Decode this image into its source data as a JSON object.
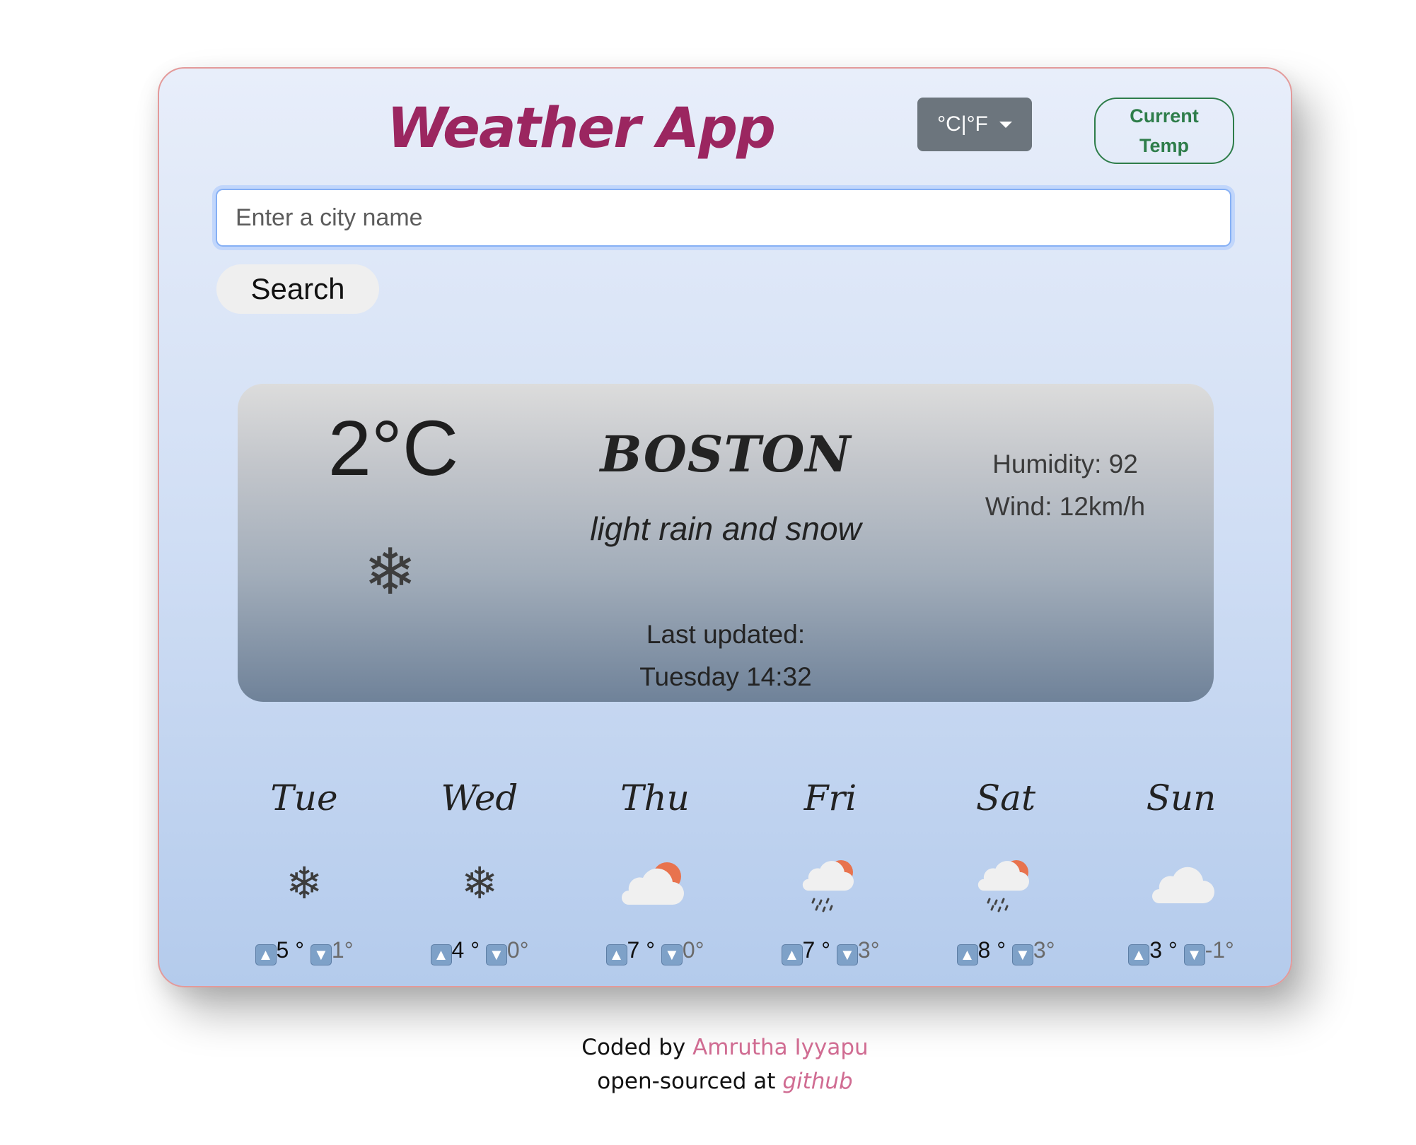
{
  "header": {
    "title": "Weather App",
    "unit_toggle_label": "°C|°F",
    "current_temp_label": "Current Temp"
  },
  "search": {
    "placeholder": "Enter a city name",
    "button_label": "Search"
  },
  "current": {
    "temperature": "2°C",
    "icon": "snowflake-icon",
    "city": "BOSTON",
    "condition": "light rain and snow",
    "last_updated_label": "Last updated:",
    "last_updated_value": "Tuesday 14:32",
    "humidity": "Humidity: 92",
    "wind": "Wind: 12km/h"
  },
  "forecast": [
    {
      "day": "Tue",
      "icon": "snowflake-icon",
      "high": "5 °",
      "low": "1°"
    },
    {
      "day": "Wed",
      "icon": "snowflake-icon",
      "high": "4 °",
      "low": "0°"
    },
    {
      "day": "Thu",
      "icon": "sun-behind-cloud-icon",
      "high": "7 °",
      "low": "0°"
    },
    {
      "day": "Fri",
      "icon": "sun-cloud-rain-icon",
      "high": "7 °",
      "low": "3°"
    },
    {
      "day": "Sat",
      "icon": "sun-cloud-rain-icon",
      "high": "8 °",
      "low": "3°"
    },
    {
      "day": "Sun",
      "icon": "cloud-icon",
      "high": "3 °",
      "low": "-1°"
    }
  ],
  "footer": {
    "coded_by": "Coded by",
    "author": "Amrutha Iyyapu",
    "open_sourced": "open-sourced at",
    "repo_link": "github"
  },
  "colors": {
    "title": "#9b2660",
    "unit_button": "#6c757d",
    "current_temp_button": "#2e7d4a",
    "footer_link": "#d06c92",
    "sun": "#e8734e"
  }
}
